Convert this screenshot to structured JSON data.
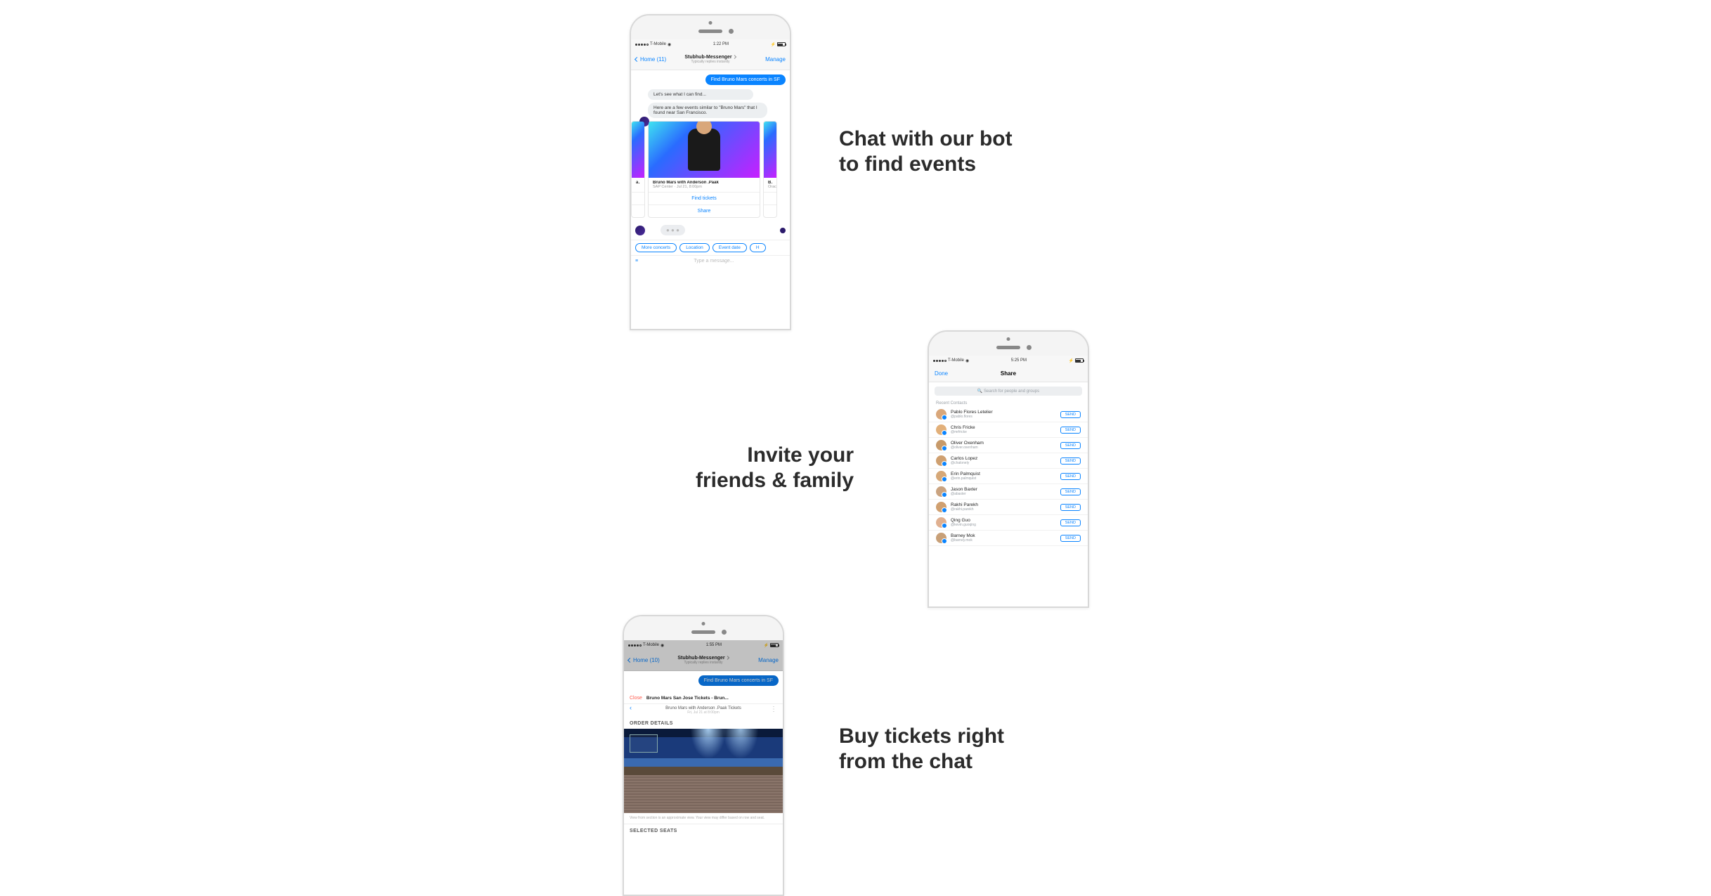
{
  "captions": {
    "c1_line1": "Chat with our bot",
    "c1_line2": "to find events",
    "c2_line1": "Invite your",
    "c2_line2": "friends & family",
    "c3_line1": "Buy tickets right",
    "c3_line2": "from the chat"
  },
  "phone1": {
    "status": {
      "carrier": "T-Mobile",
      "time": "1:22 PM"
    },
    "header": {
      "back": "Home (11)",
      "title": "Stubhub-Messenger",
      "subtitle": "Typically replies instantly",
      "action": "Manage"
    },
    "outgoing": "Find Bruno Mars concerts in SF",
    "incoming1": "Let's see what I can find...",
    "incoming2": "Here are a few events similar to \"Bruno Mars\" that I found near San Francisco.",
    "card_left_tail": "ask",
    "card": {
      "title": "Bruno Mars with Anderson .Paak",
      "subtitle": "SAP Center · Jul 21, 8:00pm",
      "btn1": "Find tickets",
      "btn2": "Share"
    },
    "card_right_head": "Bruno",
    "card_right_sub": "Oracle",
    "quick_replies": [
      "More concerts",
      "Location",
      "Event date",
      "H"
    ],
    "composer_placeholder": "Type a message..."
  },
  "phone2": {
    "status": {
      "carrier": "T-Mobile",
      "time": "5:25 PM"
    },
    "header": {
      "done": "Done",
      "title": "Share"
    },
    "search_placeholder": "Search for people and groups",
    "section": "Recent Contacts",
    "send_label": "SEND",
    "contacts": [
      {
        "name": "Pablo Flores Letelier",
        "handle": "@pablo.flores"
      },
      {
        "name": "Chris Fricke",
        "handle": "@mrfricke"
      },
      {
        "name": "Oliver Oxenham",
        "handle": "@oliver.oxenham"
      },
      {
        "name": "Carlos Lopez",
        "handle": "@chalonely"
      },
      {
        "name": "Erin Palmquist",
        "handle": "@erin.palmquist"
      },
      {
        "name": "Jason Baxter",
        "handle": "@abaxter"
      },
      {
        "name": "Rakhi Parekh",
        "handle": "@rakhi.parekh"
      },
      {
        "name": "Qing Guo",
        "handle": "@kevin.guoqing"
      },
      {
        "name": "Barney Mok",
        "handle": "@barney.mok"
      }
    ]
  },
  "phone3": {
    "status": {
      "carrier": "T-Mobile",
      "time": "1:55 PM"
    },
    "header": {
      "back": "Home (10)",
      "title": "Stubhub-Messenger",
      "subtitle": "Typically replies instantly",
      "action": "Manage"
    },
    "outgoing": "Find Bruno Mars concerts in SF",
    "webview": {
      "close": "Close",
      "title": "Bruno Mars San Jose Tickets - Brun...",
      "sub": "Bruno Mars with Anderson .Paak Tickets",
      "sub2": "Fri, Jul 21 at 8:00pm",
      "order_details": "ORDER DETAILS",
      "disclaimer": "View from section is an approximate view. Your view may differ based on row and seat.",
      "selected_seats": "SELECTED SEATS"
    }
  }
}
